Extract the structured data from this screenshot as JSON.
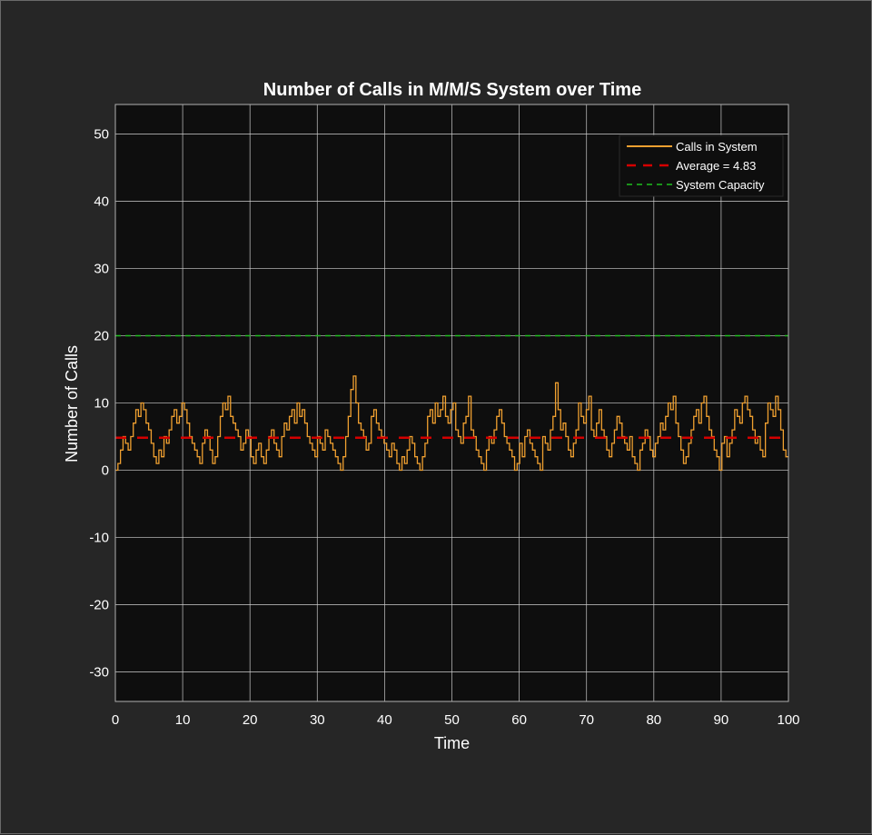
{
  "chart_data": {
    "type": "line",
    "title": "Number of Calls in M/M/S System over Time",
    "xlabel": "Time",
    "ylabel": "Number of Calls",
    "xlim": [
      0,
      100
    ],
    "ylim": [
      -34.4,
      54.4
    ],
    "xticks": [
      0,
      10,
      20,
      30,
      40,
      50,
      60,
      70,
      80,
      90,
      100
    ],
    "xtick_labels": [
      "0",
      "10",
      "20",
      "30",
      "40",
      "50",
      "60",
      "70",
      "80",
      "90",
      "100"
    ],
    "yticks": [
      -30,
      -20,
      -10,
      0,
      10,
      20,
      30,
      40,
      50
    ],
    "ytick_labels": [
      "-30",
      "-20",
      "-10",
      "0",
      "10",
      "20",
      "30",
      "40",
      "50"
    ],
    "grid": true,
    "legend_position": "top-right",
    "series": [
      {
        "name": "Calls in System",
        "style": "solid",
        "color": "#f0a030",
        "x_start": 0,
        "x_step": 0.5,
        "values": [
          0,
          1,
          3,
          5,
          4,
          3,
          5,
          7,
          9,
          8,
          10,
          9,
          7,
          6,
          4,
          2,
          1,
          3,
          2,
          5,
          4,
          6,
          8,
          9,
          7,
          8,
          10,
          9,
          7,
          5,
          4,
          3,
          2,
          1,
          4,
          6,
          5,
          3,
          1,
          2,
          5,
          8,
          10,
          9,
          11,
          8,
          7,
          6,
          5,
          3,
          4,
          6,
          5,
          2,
          1,
          3,
          4,
          2,
          1,
          3,
          5,
          6,
          4,
          3,
          2,
          5,
          7,
          6,
          8,
          9,
          7,
          10,
          8,
          9,
          7,
          5,
          4,
          3,
          2,
          5,
          4,
          3,
          6,
          5,
          4,
          3,
          2,
          1,
          0,
          2,
          5,
          8,
          12,
          14,
          10,
          7,
          6,
          5,
          3,
          4,
          8,
          9,
          7,
          6,
          5,
          4,
          3,
          2,
          4,
          3,
          1,
          0,
          2,
          1,
          3,
          5,
          4,
          2,
          1,
          0,
          2,
          4,
          8,
          9,
          7,
          10,
          8,
          9,
          11,
          8,
          7,
          9,
          10,
          6,
          5,
          4,
          7,
          8,
          11,
          6,
          5,
          3,
          2,
          1,
          0,
          3,
          5,
          4,
          6,
          8,
          9,
          7,
          5,
          4,
          3,
          2,
          0,
          1,
          4,
          2,
          5,
          6,
          4,
          3,
          2,
          1,
          0,
          5,
          4,
          3,
          6,
          8,
          13,
          9,
          6,
          7,
          5,
          3,
          2,
          4,
          6,
          10,
          8,
          7,
          9,
          11,
          6,
          5,
          7,
          9,
          6,
          5,
          3,
          2,
          4,
          6,
          8,
          7,
          5,
          4,
          3,
          5,
          2,
          1,
          0,
          3,
          4,
          6,
          5,
          3,
          2,
          4,
          5,
          7,
          6,
          8,
          10,
          9,
          11,
          7,
          5,
          3,
          1,
          2,
          4,
          6,
          8,
          9,
          7,
          10,
          11,
          8,
          6,
          5,
          3,
          2,
          0,
          4,
          5,
          2,
          4,
          6,
          9,
          8,
          7,
          10,
          11,
          9,
          8,
          6,
          4,
          5,
          3,
          2,
          7,
          10,
          9,
          8,
          11,
          9,
          6,
          3,
          2
        ],
        "x_end_note": "values sampled every 0.4 time units approximately; script stretches across xlim"
      },
      {
        "name": "Average = 4.83",
        "style": "dashed",
        "color": "#d40000",
        "constant": 4.83
      },
      {
        "name": "System Capacity",
        "style": "dashed",
        "color": "#1fbf1f",
        "constant": 20
      }
    ],
    "legend": [
      "Calls in System",
      "Average = 4.83",
      "System Capacity"
    ]
  },
  "colors": {
    "figure_bg": "#262626",
    "axes_bg": "#0e0e0e",
    "grid": "#d0d0d0",
    "text": "#ffffff"
  }
}
